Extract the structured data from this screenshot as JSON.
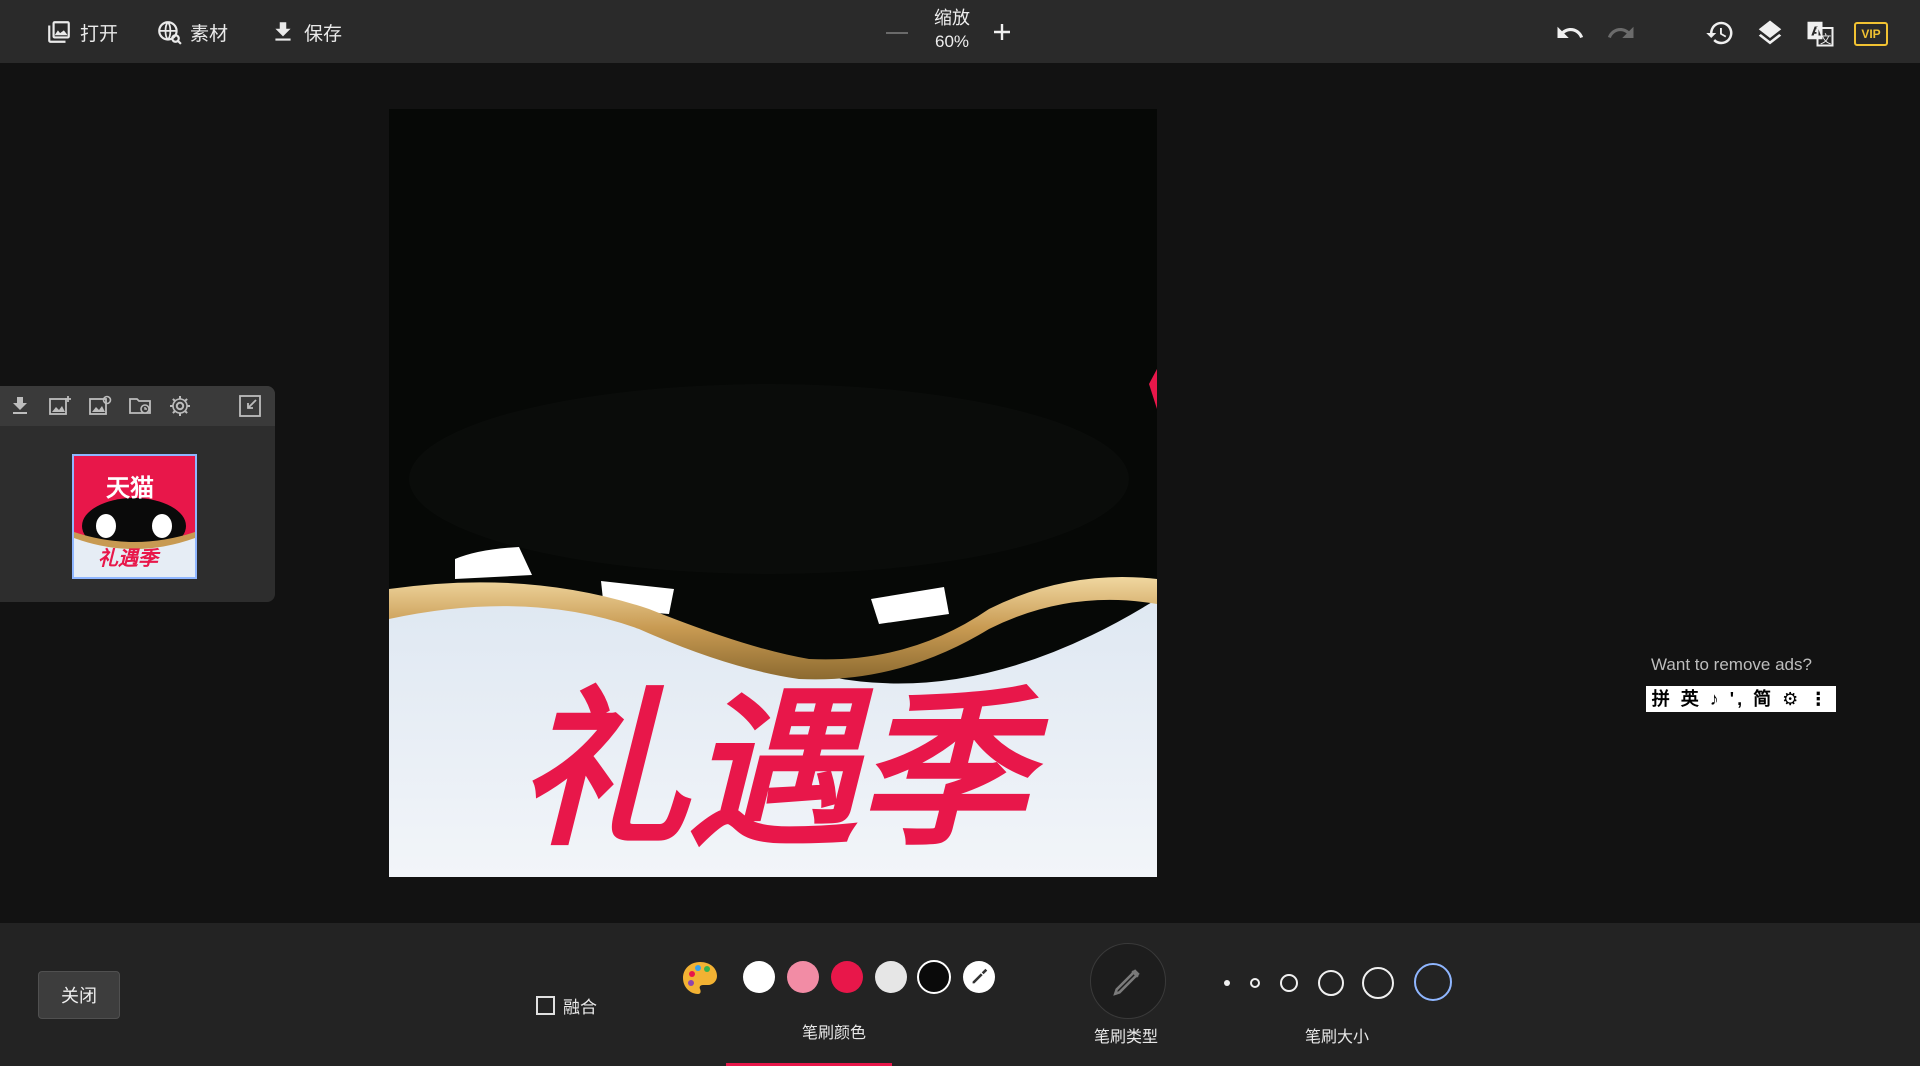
{
  "toolbar": {
    "open_label": "打开",
    "assets_label": "素材",
    "save_label": "保存",
    "zoom_label": "缩放",
    "zoom_value": "60%",
    "vip_label": "VIP",
    "icons": [
      "image-open-icon",
      "globe-icon",
      "download-icon",
      "zoom-minus-icon",
      "zoom-plus-icon",
      "undo-icon",
      "redo-icon",
      "history-icon",
      "layers-icon",
      "translate-icon",
      "vip-icon"
    ]
  },
  "canvas_image": {
    "headline": "礼遇季",
    "colors": {
      "background": "#060806",
      "headline": "#e8174a",
      "ribbon": "#c9a45b",
      "snow": "#e8eef6"
    }
  },
  "left_panel": {
    "icons": [
      "download-icon",
      "add-image-icon",
      "image-edit-icon",
      "folder-icon",
      "gear-icon",
      "collapse-icon"
    ],
    "thumbnail": {
      "title": "天猫",
      "subtitle": "礼遇季"
    }
  },
  "ads": {
    "prompt": "Want to remove ads?",
    "ime_bar": "拼 英 ♪ ', 简 ⚙ ⋮"
  },
  "bottom": {
    "close_label": "关闭",
    "blend_label": "融合",
    "brush_color_label": "笔刷颜色",
    "brush_type_label": "笔刷类型",
    "brush_size_label": "笔刷大小",
    "swatches": [
      "#ffffff",
      "#f28ca5",
      "#e8174a",
      "#e6e6e6",
      "#0a0a0a"
    ],
    "accent": "#e8174a"
  }
}
